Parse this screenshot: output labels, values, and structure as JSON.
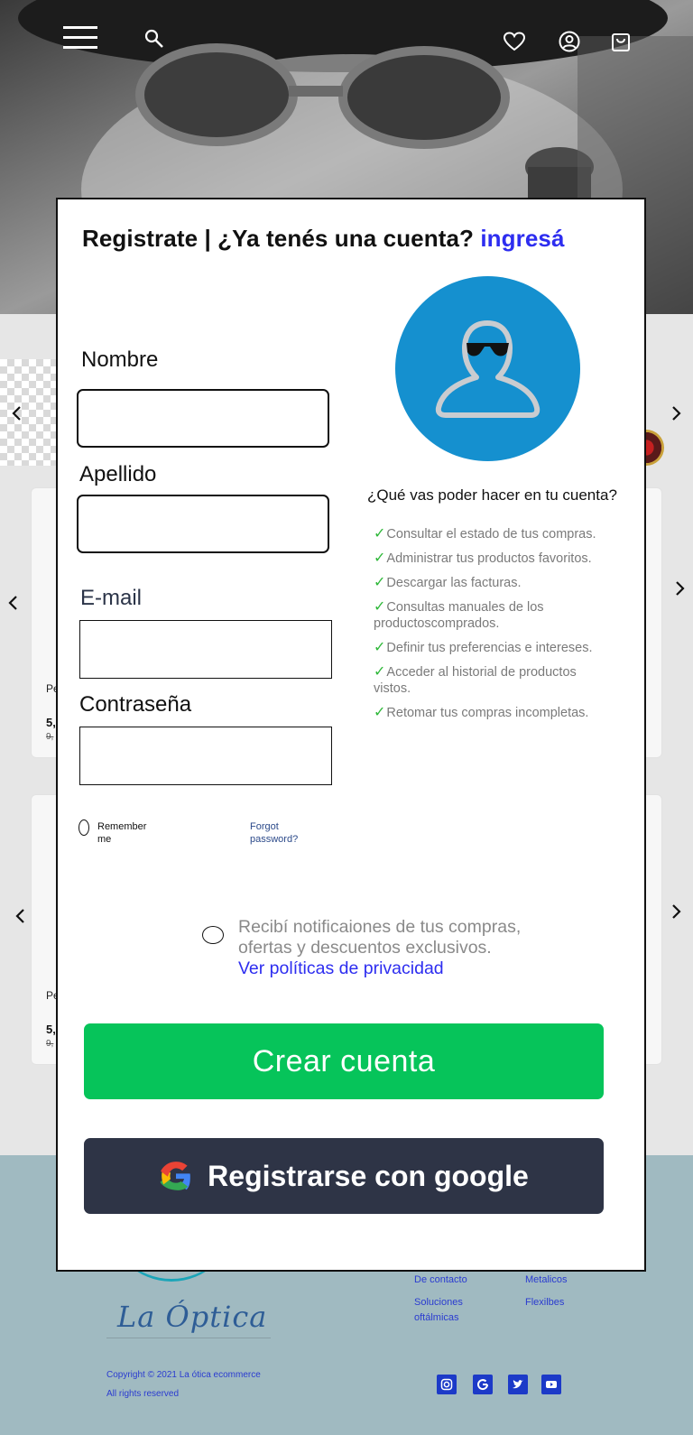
{
  "header": {
    "menu_icon": "hamburger-icon",
    "search_icon": "search-icon",
    "favorites_icon": "heart-icon",
    "account_icon": "user-circle-icon",
    "cart_icon": "shopping-bag-icon"
  },
  "products": {
    "row1": {
      "name": "Pe",
      "price": "5,",
      "old_price": "9,"
    },
    "row2": {
      "name": "Pe",
      "price": "5,",
      "old_price": "9,"
    }
  },
  "modal": {
    "title_main": "Registrate | ¿Ya tenés una cuenta? ",
    "title_link": "ingresá",
    "fields": {
      "nombre_label": "Nombre",
      "apellido_label": "Apellido",
      "email_label": "E-mail",
      "password_label": "Contraseña"
    },
    "remember_me": "Remember me",
    "forgot_password": "Forgot password?",
    "benefits_heading": "¿Qué vas poder hacer en tu cuenta?",
    "benefits": [
      "Consultar el estado de tus compras.",
      "Administrar tus productos favoritos.",
      "Descargar las facturas.",
      "Consultas manuales de los productoscomprados.",
      "Definir tus preferencias e intereses.",
      "Acceder al historial de productos vistos.",
      "Retomar tus compras incompletas."
    ],
    "check_mark": "✓",
    "notify_text": "Recibí notificaiones de tus compras, ofertas y descuentos exclusivos.",
    "privacy_link": "Ver políticas de privacidad",
    "create_button": "Crear cuenta",
    "google_button": "Registrarse con google"
  },
  "footer": {
    "brand": "La Óptica",
    "links_col1": [
      "De contacto",
      "Soluciones oftálmicas"
    ],
    "links_col2": [
      "Metalicos",
      "Flexilbes"
    ],
    "copyright": "Copyright © 2021 La ótica ecommerce",
    "rights": "All rights reserved",
    "social_icons": [
      "instagram-icon",
      "google-icon",
      "twitter-icon",
      "youtube-icon"
    ]
  },
  "colors": {
    "accent_link": "#2d2df0",
    "create_button": "#06c45a",
    "google_button": "#2e3446",
    "avatar_bg": "#1590cf",
    "check": "#2fb83a",
    "footer_bg": "#a0bac1"
  }
}
